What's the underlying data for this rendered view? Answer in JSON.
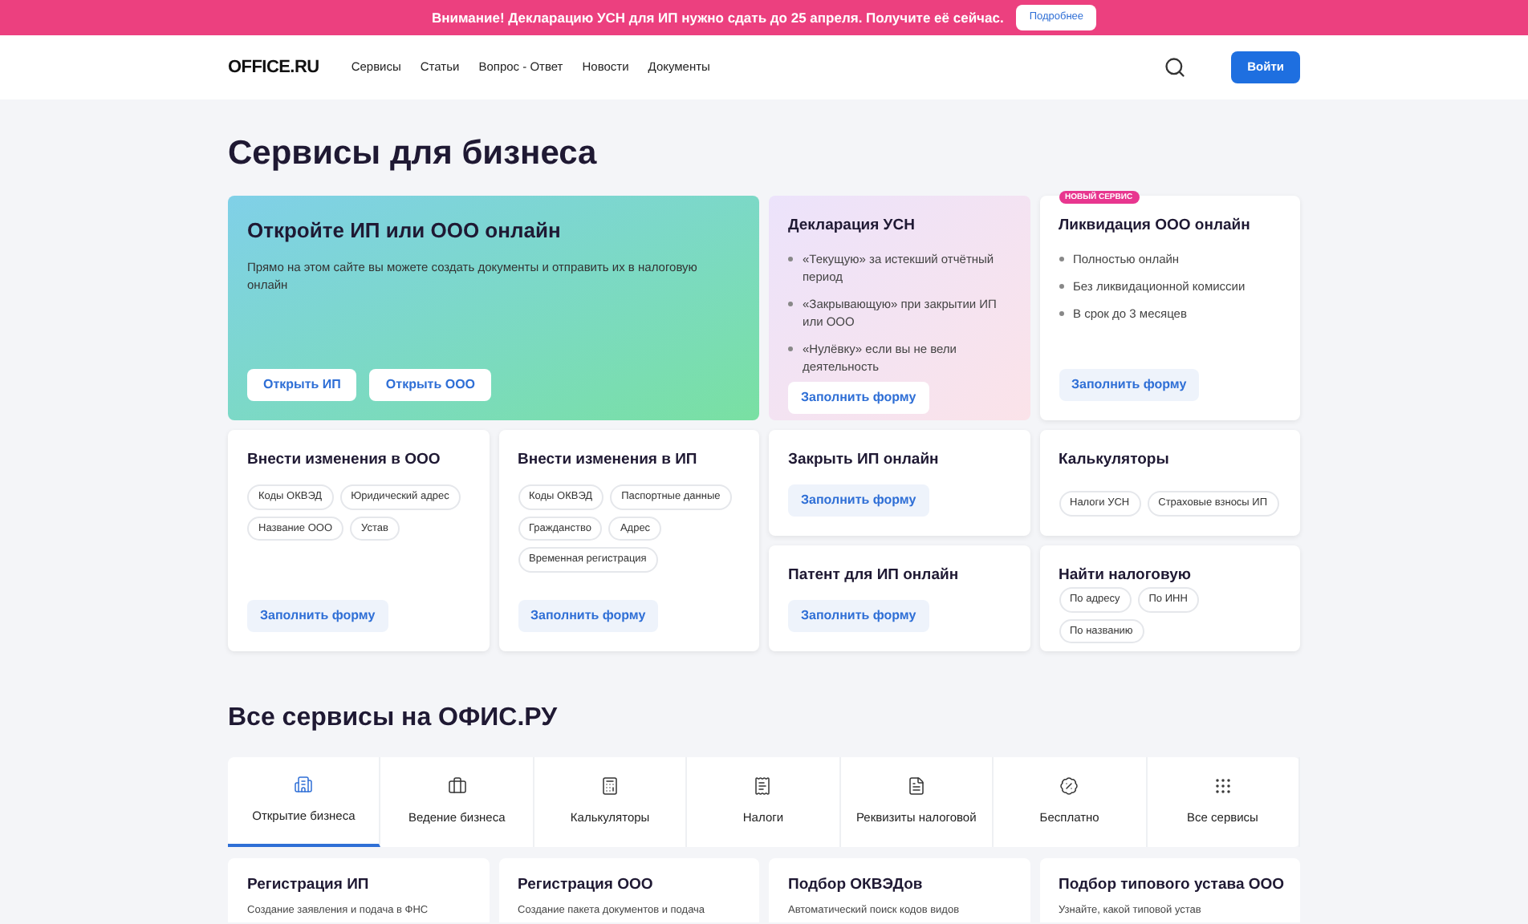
{
  "banner": {
    "text": "Внимание! Декларацию УСН для ИП нужно сдать до 25 апреля. Получите её сейчас.",
    "button": "Подробнее"
  },
  "header": {
    "logo": "OFFICE.RU",
    "nav": [
      "Сервисы",
      "Статьи",
      "Вопрос - Ответ",
      "Новости",
      "Документы"
    ],
    "login": "Войти"
  },
  "title": "Сервисы для бизнеса",
  "hero": {
    "title": "Откройте ИП или ООО онлайн",
    "text": "Прямо на этом сайте вы можете создать документы и отправить их в налоговую онлайн",
    "buttons": [
      "Открыть ИП",
      "Открыть ООО"
    ]
  },
  "declaration": {
    "title": "Декларация УСН",
    "items": [
      "«Текущую» за истекший отчётный период",
      "«Закрывающую» при закрытии ИП или ООО",
      "«Нулёвку» если вы не вели деятельность"
    ],
    "button": "Заполнить форму"
  },
  "liquidation": {
    "badge": "НОВЫЙ СЕРВИС",
    "title": "Ликвидация ООО онлайн",
    "items": [
      "Полностью онлайн",
      "Без ликвидационной комиссии",
      "В срок до 3 месяцев"
    ],
    "button": "Заполнить форму"
  },
  "changes": [
    {
      "title": "Внести изменения в ООО",
      "tags": [
        "Коды ОКВЭД",
        "Юридический адрес",
        "Название ООО",
        "Устав"
      ],
      "button": "Заполнить форму"
    },
    {
      "title": "Внести изменения в ИП",
      "tags": [
        "Коды ОКВЭД",
        "Паспортные данные",
        "Гражданство",
        "Адрес",
        "Временная регистрация"
      ],
      "button": "Заполнить форму"
    }
  ],
  "small_cards": [
    {
      "kind": "button",
      "title": "Закрыть ИП онлайн",
      "button": "Заполнить форму"
    },
    {
      "kind": "tags",
      "title": "Калькуляторы",
      "tags": [
        "Налоги УСН",
        "Страховые взносы ИП"
      ]
    },
    {
      "kind": "button",
      "title": "Патент для ИП онлайн",
      "button": "Заполнить форму"
    },
    {
      "kind": "tags",
      "title": "Найти налоговую",
      "tags": [
        "По адресу",
        "По ИНН",
        "По названию"
      ]
    }
  ],
  "all_title": "Все сервисы на ОФИС.РУ",
  "tabs": [
    {
      "label": "Открытие бизнеса",
      "selected": true
    },
    {
      "label": "Ведение бизнеса",
      "selected": false
    },
    {
      "label": "Калькуляторы",
      "selected": false
    },
    {
      "label": "Налоги",
      "selected": false
    },
    {
      "label": "Реквизиты налоговой",
      "selected": false
    },
    {
      "label": "Бесплатно",
      "selected": false
    },
    {
      "label": "Все сервисы",
      "selected": false
    }
  ],
  "services": [
    {
      "title": "Регистрация ИП",
      "text": "Создание заявления и подача в ФНС"
    },
    {
      "title": "Регистрация ООО",
      "text": "Создание пакета документов и подача"
    },
    {
      "title": "Подбор ОКВЭДов",
      "text": "Автоматический поиск кодов видов"
    },
    {
      "title": "Подбор типового устава ООО",
      "text": "Узнайте, какой типовой устав"
    }
  ]
}
